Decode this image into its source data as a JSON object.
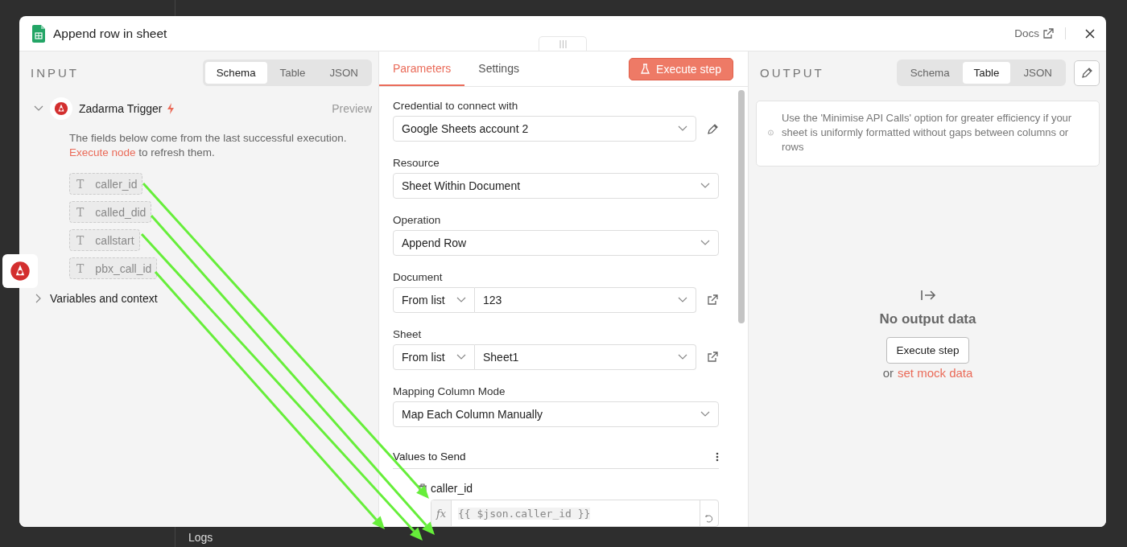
{
  "window": {
    "title": "Append row in sheet",
    "docs_link": "Docs"
  },
  "input": {
    "heading": "INPUT",
    "view_tabs": [
      {
        "label": "Schema",
        "selected": true
      },
      {
        "label": "Table",
        "selected": false
      },
      {
        "label": "JSON",
        "selected": false
      }
    ],
    "node": {
      "name": "Zadarma Trigger",
      "expanded": true,
      "preview": "Preview",
      "hint_before": "The fields below come from the last successful execution. ",
      "hint_link": "Execute node",
      "hint_after": " to refresh them.",
      "fields": [
        {
          "type_glyph": "T",
          "name": "caller_id"
        },
        {
          "type_glyph": "T",
          "name": "called_did"
        },
        {
          "type_glyph": "T",
          "name": "callstart"
        },
        {
          "type_glyph": "T",
          "name": "pbx_call_id"
        }
      ]
    },
    "variables": {
      "label": "Variables and context",
      "expanded": false
    }
  },
  "parameters": {
    "tabs": [
      {
        "label": "Parameters",
        "selected": true
      },
      {
        "label": "Settings",
        "selected": false
      }
    ],
    "execute_button": "Execute step",
    "fields": [
      {
        "kind": "credential",
        "label": "Credential to connect with",
        "value": "Google Sheets account 2"
      },
      {
        "kind": "select",
        "label": "Resource",
        "value": "Sheet Within Document"
      },
      {
        "kind": "select",
        "label": "Operation",
        "value": "Append Row"
      },
      {
        "kind": "locator",
        "label": "Document",
        "mode": "From list",
        "value": "123"
      },
      {
        "kind": "locator",
        "label": "Sheet",
        "mode": "From list",
        "value": "Sheet1"
      },
      {
        "kind": "select",
        "label": "Mapping Column Mode",
        "value": "Map Each Column Manually"
      }
    ],
    "values_section": {
      "heading": "Values to Send",
      "columns": [
        {
          "name": "caller_id",
          "fx": "fx",
          "expression": "{{ $json.caller_id }}"
        }
      ]
    }
  },
  "output": {
    "heading": "OUTPUT",
    "view_tabs": [
      {
        "label": "Schema",
        "selected": false
      },
      {
        "label": "Table",
        "selected": true
      },
      {
        "label": "JSON",
        "selected": false
      }
    ],
    "notice": "Use the 'Minimise API Calls' option for greater efficiency if your sheet is uniformly formatted without gaps between columns or rows",
    "empty_title": "No output data",
    "execute_button": "Execute step",
    "or_text": "or",
    "mock_link": "set mock data"
  },
  "background": {
    "logs_label": "Logs"
  },
  "annotation_arrows": [
    {
      "kind": "drag"
    },
    {
      "kind": "drag"
    },
    {
      "kind": "drag"
    },
    {
      "kind": "drag"
    }
  ]
}
